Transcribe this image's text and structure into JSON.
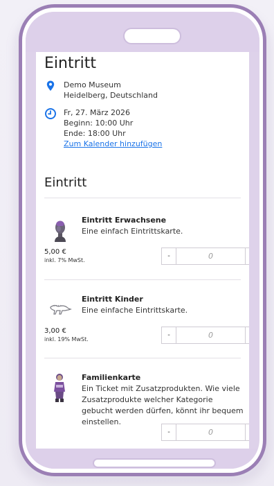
{
  "page": {
    "title": "Eintritt"
  },
  "location": {
    "icon": "map-pin-icon",
    "line1": "Demo Museum",
    "line2": "Heidelberg, Deutschland"
  },
  "datetime": {
    "icon": "clock-icon",
    "date": "Fr, 27. März 2026",
    "start": "Beginn: 10:00 Uhr",
    "end": "Ende: 18:00 Uhr",
    "calendar_link": "Zum Kalender hinzufügen"
  },
  "section": {
    "title": "Eintritt"
  },
  "tickets": [
    {
      "name": "Eintritt Erwachsene",
      "description": "Eine einfach Eintrittskarte.",
      "price": "5,00 €",
      "vat": "inkl. 7% MwSt.",
      "qty_placeholder": "0",
      "minus": "-",
      "plus": "+"
    },
    {
      "name": "Eintritt Kinder",
      "description": "Eine einfache Eintrittskarte.",
      "price": "3,00 €",
      "vat": "inkl. 19% MwSt.",
      "qty_placeholder": "0",
      "minus": "-",
      "plus": "+"
    },
    {
      "name": "Familienkarte",
      "description": "Ein Ticket mit Zusatzprodukten. Wie viele Zusatzprodukte welcher Kategorie gebucht werden dürfen, könnt ihr bequem einstellen.",
      "qty_placeholder": "0",
      "minus": "-",
      "plus": "+"
    }
  ],
  "colors": {
    "accent_blue": "#1a73e8",
    "phone_frame": "#9b7fb5",
    "phone_bars": "#ddd0ea"
  }
}
